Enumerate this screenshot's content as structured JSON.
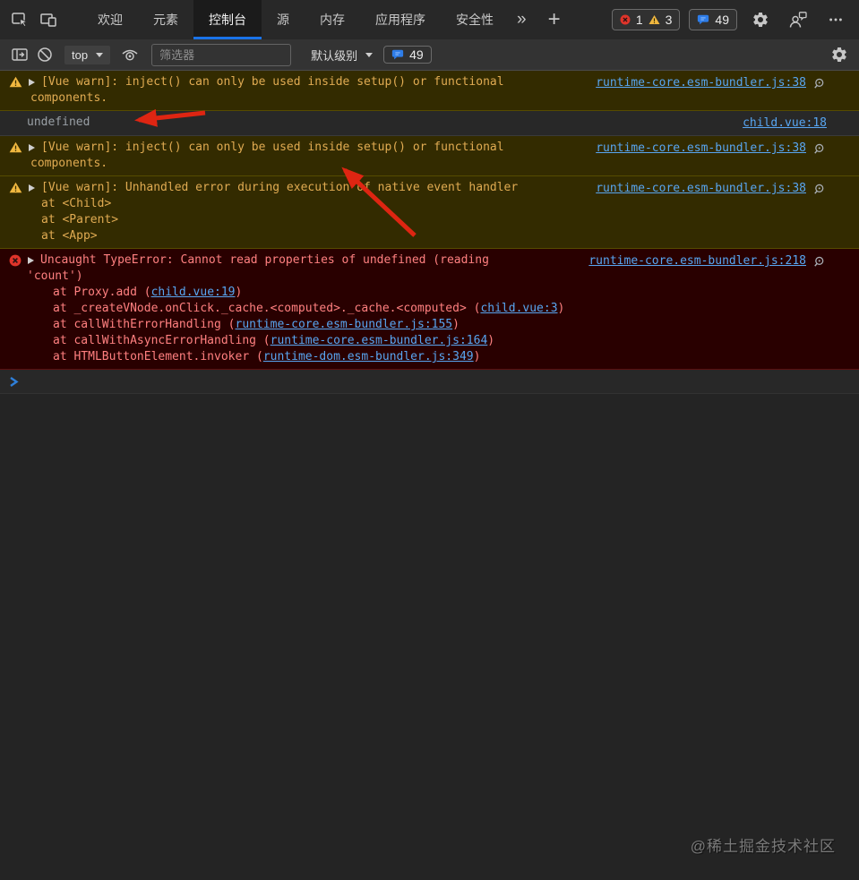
{
  "colors": {
    "accent_blue": "#1a73e8",
    "link_blue": "#58a6f2",
    "warning_bg": "#332b00",
    "warning_text": "#e0ab52",
    "error_bg": "#290000",
    "error_text": "#ff8080",
    "annotation_arrow_red": "#de2512"
  },
  "tabbar": {
    "tabs": [
      "欢迎",
      "元素",
      "控制台",
      "源",
      "内存",
      "应用程序",
      "安全性"
    ],
    "active_tab": "控制台",
    "icons": {
      "more_tabs": "»",
      "add": "+"
    },
    "error_count": "1",
    "warning_count": "3",
    "message_count": "49"
  },
  "toolbar": {
    "context": "top",
    "filter_placeholder": "筛选器",
    "level": "默认级别",
    "message_count": "49"
  },
  "console": {
    "warn1": {
      "line1": "[Vue warn]: inject() can only be used inside setup() or functional",
      "line2": "components.",
      "source": "runtime-core.esm-bundler.js:38"
    },
    "undefined_log": {
      "text": "undefined",
      "source": "child.vue:18"
    },
    "warn2": {
      "line1": "[Vue warn]: inject() can only be used inside setup() or functional",
      "line2": "components.",
      "source": "runtime-core.esm-bundler.js:38"
    },
    "warn3": {
      "line1": "[Vue warn]: Unhandled error during execution of native event handler",
      "stack": [
        "at <Child>",
        "at <Parent>",
        "at <App>"
      ],
      "source": "runtime-core.esm-bundler.js:38"
    },
    "error": {
      "line1": "Uncaught TypeError: Cannot read properties of undefined (reading",
      "line2": "'count')",
      "stack": [
        {
          "prefix": "at Proxy.add (",
          "link": "child.vue:19",
          "suffix": ")"
        },
        {
          "prefix": "at _createVNode.onClick._cache.<computed>._cache.<computed> (",
          "link": "child.vue:3",
          "suffix": ")"
        },
        {
          "prefix": "at callWithErrorHandling (",
          "link": "runtime-core.esm-bundler.js:155",
          "suffix": ")"
        },
        {
          "prefix": "at callWithAsyncErrorHandling (",
          "link": "runtime-core.esm-bundler.js:164",
          "suffix": ")"
        },
        {
          "prefix": "at HTMLButtonElement.invoker (",
          "link": "runtime-dom.esm-bundler.js:349",
          "suffix": ")"
        }
      ],
      "source": "runtime-core.esm-bundler.js:218"
    }
  },
  "watermark": "@稀土掘金技术社区"
}
